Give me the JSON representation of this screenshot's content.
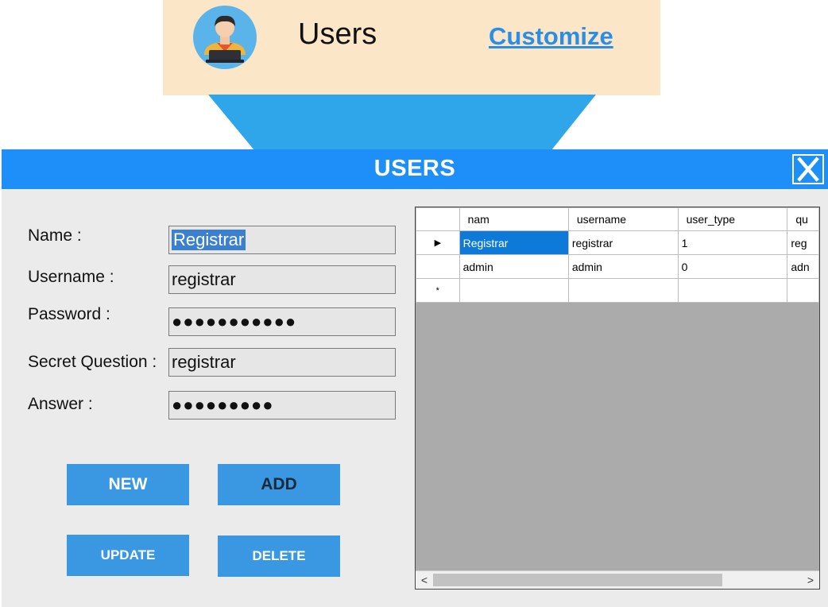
{
  "callout": {
    "title": "Users",
    "link": "Customize"
  },
  "window": {
    "title": "USERS",
    "close_glyph": "X"
  },
  "form": {
    "fields": [
      {
        "label": "Name :",
        "value": "Registrar",
        "type": "text"
      },
      {
        "label": "Username :",
        "value": "registrar",
        "type": "text"
      },
      {
        "label": "Password :",
        "value": "●●●●●●●●●●●",
        "type": "password"
      },
      {
        "label": "Secret Question :",
        "value": "registrar",
        "type": "text"
      },
      {
        "label": "Answer :",
        "value": "●●●●●●●●●",
        "type": "password"
      }
    ]
  },
  "buttons": {
    "new": "NEW",
    "add": "ADD",
    "update": "UPDATE",
    "delete": "DELETE"
  },
  "grid": {
    "columns": [
      "nam",
      "username",
      "user_type",
      "qu"
    ],
    "rows": [
      {
        "indicator": "▶",
        "cells": [
          "Registrar",
          "registrar",
          "1",
          "reg"
        ]
      },
      {
        "indicator": "",
        "cells": [
          "admin",
          "admin",
          "0",
          "adn"
        ]
      },
      {
        "indicator": "*",
        "cells": [
          "",
          "",
          "",
          ""
        ]
      }
    ],
    "scroll_left": "<",
    "scroll_right": ">"
  },
  "colors": {
    "accent": "#1e8ff8",
    "button": "#3a97e2",
    "callout_bg": "#fce6c8",
    "selected_cell": "#0d79d8"
  }
}
